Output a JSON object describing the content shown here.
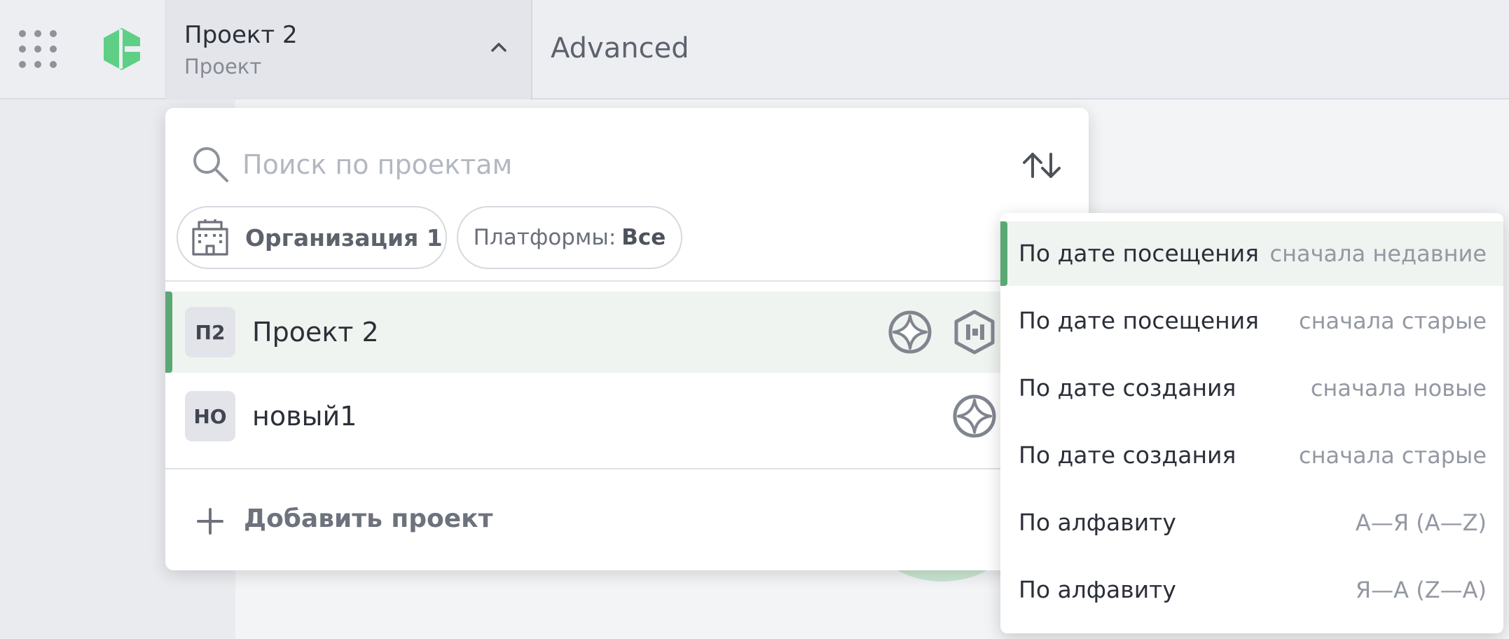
{
  "header": {
    "project_name": "Проект 2",
    "project_type": "Проект",
    "section_title": "Advanced"
  },
  "projects_dropdown": {
    "search_placeholder": "Поиск по проектам",
    "search_value": "",
    "org_chip_label": "Организация 1",
    "platforms_chip_label": "Платформы:",
    "platforms_chip_value": "Все",
    "projects": [
      {
        "initials": "П2",
        "name": "Проект 2",
        "selected": true,
        "platform_icons": [
          "diamond-circle-icon",
          "hexagon-icon"
        ]
      },
      {
        "initials": "НО",
        "name": "новый1",
        "selected": false,
        "platform_icons": [
          "diamond-circle-icon"
        ]
      }
    ],
    "add_project_label": "Добавить проект"
  },
  "sort_menu": {
    "items": [
      {
        "label": "По дате посещения",
        "detail": "сначала недавние",
        "selected": true
      },
      {
        "label": "По дате посещения",
        "detail": "сначала старые",
        "selected": false
      },
      {
        "label": "По дате создания",
        "detail": "сначала новые",
        "selected": false
      },
      {
        "label": "По дате создания",
        "detail": "сначала старые",
        "selected": false
      },
      {
        "label": "По алфавиту",
        "detail": "А—Я (A—Z)",
        "selected": false
      },
      {
        "label": "По алфавиту",
        "detail": "Я—А (Z—A)",
        "selected": false
      }
    ]
  },
  "colors": {
    "accent_green": "#5aa874",
    "logo_green": "#5fcf86",
    "selected_row_bg": "#eff4f0"
  }
}
